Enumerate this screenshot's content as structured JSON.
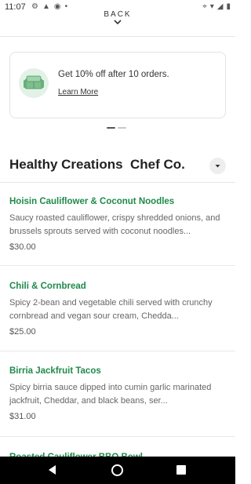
{
  "status_bar": {
    "time": "11:07",
    "left_icons": [
      "gear-icon",
      "alert-icon",
      "sync-icon",
      "dot-icon"
    ],
    "right_icons": [
      "location-icon",
      "wifi-icon",
      "signal-icon",
      "battery-icon"
    ]
  },
  "header": {
    "back_label": "BACK"
  },
  "promo": {
    "text": "Get 10% off after 10 orders.",
    "link_label": "Learn More",
    "icon": "sofa-icon",
    "accent_color": "#e2f2e6"
  },
  "pager": {
    "count": 2,
    "active_index": 0
  },
  "restaurant": {
    "title": "Healthy Creations  Chef Co."
  },
  "menu_items": [
    {
      "name": "Hoisin Cauliflower & Coconut Noodles",
      "description": "Saucy roasted cauliflower, crispy shredded onions, and brussels sprouts served with coconut noodles...",
      "price": "$30.00"
    },
    {
      "name": "Chili & Cornbread",
      "description": "Spicy 2-bean and vegetable chili served with crunchy cornbread and vegan sour cream, Chedda...",
      "price": "$25.00"
    },
    {
      "name": "Birria Jackfruit Tacos",
      "description": "Spicy birria sauce dipped into cumin garlic marinated jackfruit, Cheddar, and black beans, ser...",
      "price": "$31.00"
    }
  ],
  "peek_item": {
    "name": "Roasted Cauliflower BBQ Bowl"
  },
  "colors": {
    "item_name": "#1f8a4a",
    "nav_bar": "#000000"
  }
}
